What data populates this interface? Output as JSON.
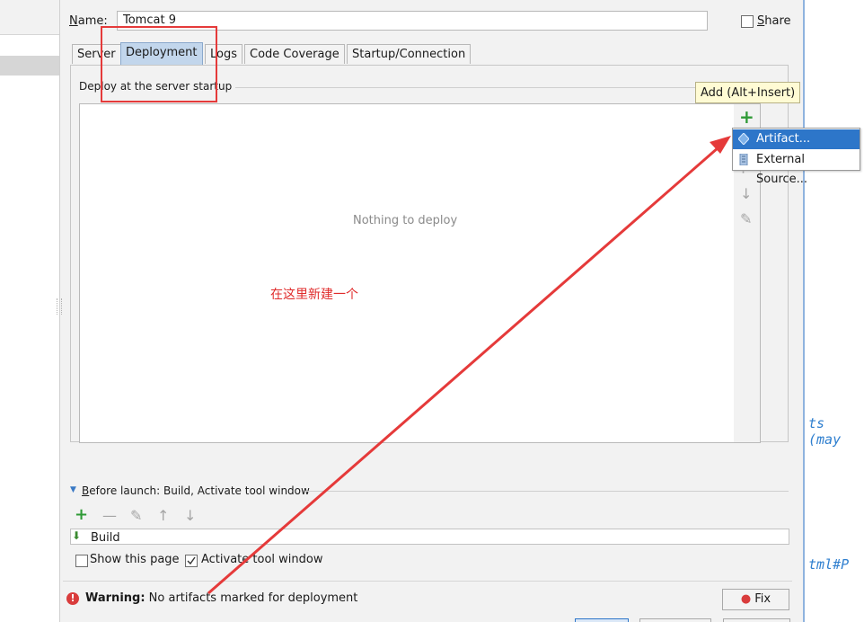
{
  "form": {
    "name_label_prefix": "N",
    "name_label_rest": "ame:",
    "name_value": "Tomcat 9",
    "share_label_prefix": "S",
    "share_label_rest": "hare"
  },
  "tabs": [
    {
      "label": "Server"
    },
    {
      "label": "Deployment"
    },
    {
      "label": "Logs"
    },
    {
      "label": "Code Coverage"
    },
    {
      "label": "Startup/Connection"
    }
  ],
  "deploy": {
    "header": "Deploy at the server startup",
    "empty_text": "Nothing to deploy",
    "annotation": "在这里新建一个"
  },
  "tooltip": "Add (Alt+Insert)",
  "popup": {
    "items": [
      {
        "label": "Artifact...",
        "icon": "artifact-icon"
      },
      {
        "label": "External Source...",
        "icon": "external-source-icon"
      }
    ]
  },
  "before_launch": {
    "label_prefix": "B",
    "label_rest": "efore launch: Build, Activate tool window",
    "build_label": "Build"
  },
  "options": {
    "show_page": "Show this page",
    "activate_tool_window": "Activate tool window"
  },
  "warning": {
    "bold": "Warning:",
    "text": "No artifacts marked for deployment",
    "fix_label": "Fix"
  },
  "editor_fragments": [
    "ts (may",
    "tml#P"
  ],
  "colors": {
    "highlight": "#e53a3a",
    "accent": "#2d76c9",
    "add_green": "#2f9a36"
  }
}
